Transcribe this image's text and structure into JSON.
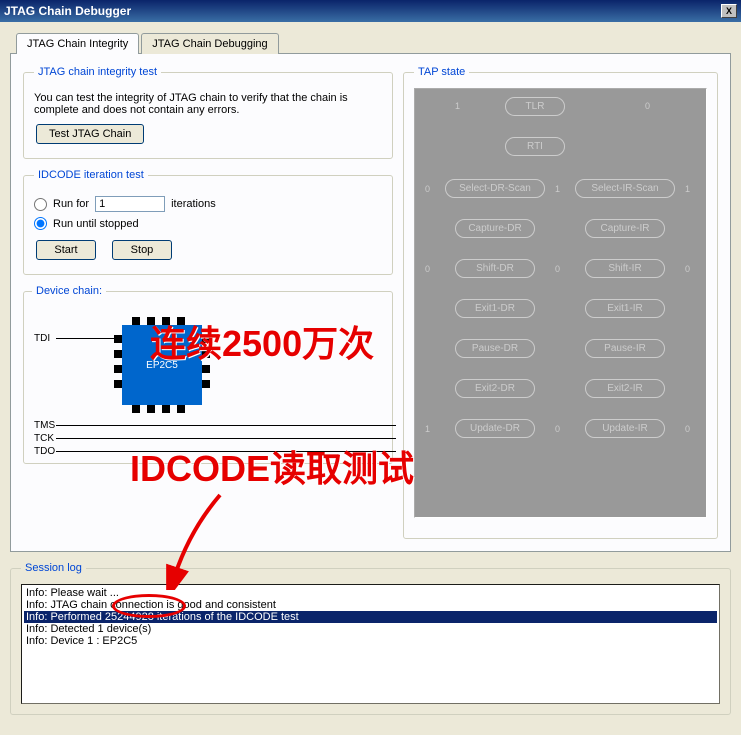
{
  "window": {
    "title": "JTAG Chain Debugger",
    "close_label": "X"
  },
  "tabs": {
    "integrity": "JTAG Chain Integrity",
    "debugging": "JTAG Chain Debugging"
  },
  "integrity_group": {
    "legend": "JTAG chain integrity test",
    "desc": "You can test the integrity of JTAG chain to verify that the chain is complete and does not contain any errors.",
    "test_btn": "Test JTAG Chain"
  },
  "idcode_group": {
    "legend": "IDCODE iteration test",
    "run_for": "Run for",
    "iterations_label": "iterations",
    "iterations_value": "1",
    "run_until": "Run until stopped",
    "start": "Start",
    "stop": "Stop"
  },
  "device_chain": {
    "legend": "Device chain:",
    "device": "EP2C5",
    "tdi": "TDI",
    "tms": "TMS",
    "tck": "TCK",
    "tdo": "TDO"
  },
  "tap": {
    "legend": "TAP state",
    "states": {
      "tlr": "TLR",
      "rti": "RTI",
      "sel_dr": "Select-DR-Scan",
      "sel_ir": "Select-IR-Scan",
      "cap_dr": "Capture-DR",
      "cap_ir": "Capture-IR",
      "shift_dr": "Shift-DR",
      "shift_ir": "Shift-IR",
      "exit1_dr": "Exit1-DR",
      "exit1_ir": "Exit1-IR",
      "pause_dr": "Pause-DR",
      "pause_ir": "Pause-IR",
      "exit2_dr": "Exit2-DR",
      "exit2_ir": "Exit2-IR",
      "update_dr": "Update-DR",
      "update_ir": "Update-IR"
    }
  },
  "session": {
    "legend": "Session log",
    "lines": [
      "Info: Please wait ...",
      "Info: JTAG chain connection is good and consistent",
      "Info: Performed 25244928 iterations of the IDCODE test",
      "Info: Detected 1 device(s)",
      "Info: Device 1 : EP2C5"
    ],
    "selected_index": 2
  },
  "annotation": {
    "line1": "连续2500万次",
    "line2": "IDCODE读取测试"
  }
}
